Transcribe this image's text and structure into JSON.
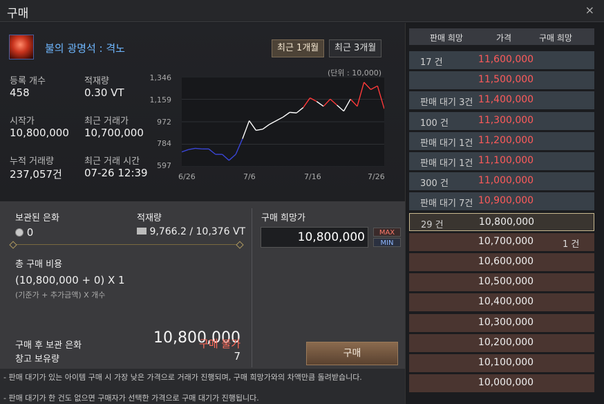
{
  "window": {
    "title": "구매",
    "close_icon": "×"
  },
  "item": {
    "name": "불의 광명석 : 격노",
    "icon": "fire-gem-icon"
  },
  "period_tabs": [
    {
      "label": "최근 1개월",
      "active": true
    },
    {
      "label": "최근 3개월",
      "active": false
    }
  ],
  "stats": {
    "registered_label": "등록 개수",
    "registered_value": "458",
    "load_label": "적재량",
    "load_value": "0.30 VT",
    "start_price_label": "시작가",
    "start_price_value": "10,800,000",
    "recent_price_label": "최근 거래가",
    "recent_price_value": "10,700,000",
    "total_trades_label": "누적 거래량",
    "total_trades_value": "237,057건",
    "recent_time_label": "최근 거래 시간",
    "recent_time_value": "07-26 12:39"
  },
  "chart_data": {
    "type": "line",
    "unit_label": "(단위 : 10,000)",
    "y_ticks": [
      "1,346",
      "1,159",
      "972",
      "784",
      "597"
    ],
    "ylim": [
      597,
      1346
    ],
    "x_ticks": [
      "6/26",
      "7/6",
      "7/16",
      "7/26"
    ],
    "grid": true,
    "colors": {
      "low": "#3a46d8",
      "mid": "#ffffff",
      "high": "#ff3a3a"
    },
    "x": [
      0,
      1,
      2,
      3,
      4,
      5,
      6,
      7,
      8,
      9,
      10,
      11,
      12,
      13,
      14,
      15,
      16,
      17,
      18,
      19,
      20,
      21,
      22,
      23,
      24,
      25,
      26,
      27,
      28,
      29,
      30
    ],
    "values": [
      720,
      740,
      750,
      745,
      745,
      700,
      700,
      650,
      700,
      830,
      980,
      900,
      910,
      950,
      980,
      1010,
      1050,
      1045,
      1090,
      1170,
      1140,
      1100,
      1160,
      1110,
      1060,
      1160,
      1100,
      1300,
      1240,
      1270,
      1080
    ]
  },
  "holding": {
    "silver_label": "보관된 은화",
    "silver_value": "0",
    "silver_icon": "silver-coin-icon",
    "weight_label": "적재량",
    "weight_value": "9,766.2 / 10,376 VT",
    "weight_icon": "weight-icon"
  },
  "purchase": {
    "desired_price_label": "구매 희망가",
    "desired_price_value": "10,800,000",
    "max_label": "MAX",
    "min_label": "MIN",
    "total_cost_label": "총 구매 비용",
    "formula": "(10,800,000 + 0) X 1",
    "formula_note": "(기준가 + 추가금액) X 개수",
    "total_value": "10,800,000",
    "after_silver_label": "구매 후 보관 은화",
    "after_silver_value": "구매 불가",
    "storage_qty_label": "창고 보유량",
    "storage_qty_value": "7",
    "buy_button": "구매"
  },
  "notes": [
    "- 판매 대기가 있는 아이템 구매 시 가장 낮은 가격으로 거래가 진행되며, 구매 희망가와의 차액만큼 돌려받습니다.",
    "- 판매 대기가 한 건도 없으면 구매자가 선택한 가격으로 구매 대기가 진행됩니다."
  ],
  "order_book": {
    "headers": {
      "sell": "판매 희망",
      "price": "가격",
      "buy": "구매 희망"
    },
    "rows": [
      {
        "sell": "17 건",
        "price": "11,600,000",
        "buy": "",
        "kind": "sell"
      },
      {
        "sell": "",
        "price": "11,500,000",
        "buy": "",
        "kind": "sell"
      },
      {
        "sell": "판매 대기 3건",
        "price": "11,400,000",
        "buy": "",
        "kind": "sell"
      },
      {
        "sell": "100 건",
        "price": "11,300,000",
        "buy": "",
        "kind": "sell"
      },
      {
        "sell": "판매 대기 1건",
        "price": "11,200,000",
        "buy": "",
        "kind": "sell"
      },
      {
        "sell": "판매 대기 1건",
        "price": "11,100,000",
        "buy": "",
        "kind": "sell"
      },
      {
        "sell": "300 건",
        "price": "11,000,000",
        "buy": "",
        "kind": "sell"
      },
      {
        "sell": "판매 대기 7건",
        "price": "10,900,000",
        "buy": "",
        "kind": "sell"
      },
      {
        "sell": "29 건",
        "price": "10,800,000",
        "buy": "",
        "kind": "current"
      },
      {
        "sell": "",
        "price": "10,700,000",
        "buy": "1 건",
        "kind": "buy"
      },
      {
        "sell": "",
        "price": "10,600,000",
        "buy": "",
        "kind": "buy"
      },
      {
        "sell": "",
        "price": "10,500,000",
        "buy": "",
        "kind": "buy"
      },
      {
        "sell": "",
        "price": "10,400,000",
        "buy": "",
        "kind": "buy"
      },
      {
        "sell": "",
        "price": "10,300,000",
        "buy": "",
        "kind": "buy"
      },
      {
        "sell": "",
        "price": "10,200,000",
        "buy": "",
        "kind": "buy"
      },
      {
        "sell": "",
        "price": "10,100,000",
        "buy": "",
        "kind": "buy"
      },
      {
        "sell": "",
        "price": "10,000,000",
        "buy": "",
        "kind": "buy"
      }
    ]
  }
}
